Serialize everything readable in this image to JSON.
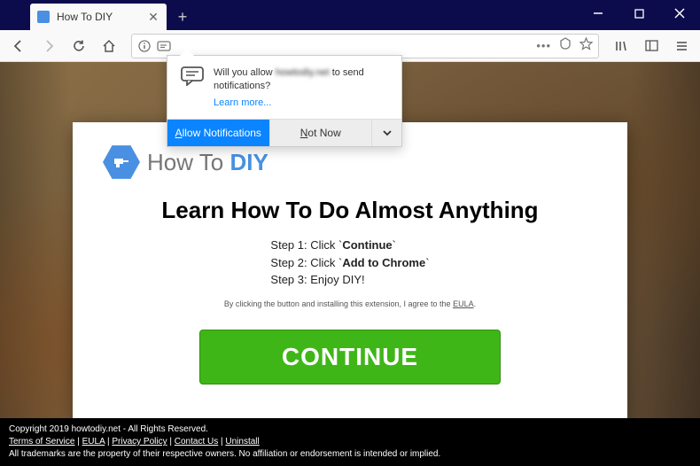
{
  "tab": {
    "title": "How To DIY"
  },
  "notification": {
    "prefix": "Will you allow ",
    "blurred": "howtodiy.net",
    "suffix": " to send notifications?",
    "learn": "Learn more...",
    "allow_prefix": "A",
    "allow_rest": "llow Notifications",
    "notnow_prefix": "N",
    "notnow_rest": "ot Now"
  },
  "modal": {
    "logo_howto": "How To ",
    "logo_diy": "DIY",
    "headline": "Learn How To Do Almost Anything",
    "step1_a": "Step 1: Click `",
    "step1_b": "Continue",
    "step1_c": "`",
    "step2_a": "Step 2: Click `",
    "step2_b": "Add to Chrome",
    "step2_c": "`",
    "step3": "Step 3: Enjoy DIY!",
    "disclaimer_a": "By clicking the button and installing this extension, I agree to the ",
    "disclaimer_b": "EULA",
    "disclaimer_c": ".",
    "continue": "CONTINUE"
  },
  "footer": {
    "copyright": "Copyright 2019 howtodiy.net - All Rights Reserved.",
    "tos": "Terms of Service",
    "eula": "EULA",
    "privacy": "Privacy Policy",
    "contact": "Contact Us",
    "uninstall": "Uninstall",
    "sep": " | ",
    "trademark": "All trademarks are the property of their respective owners. No affiliation or endorsement is intended or implied."
  }
}
